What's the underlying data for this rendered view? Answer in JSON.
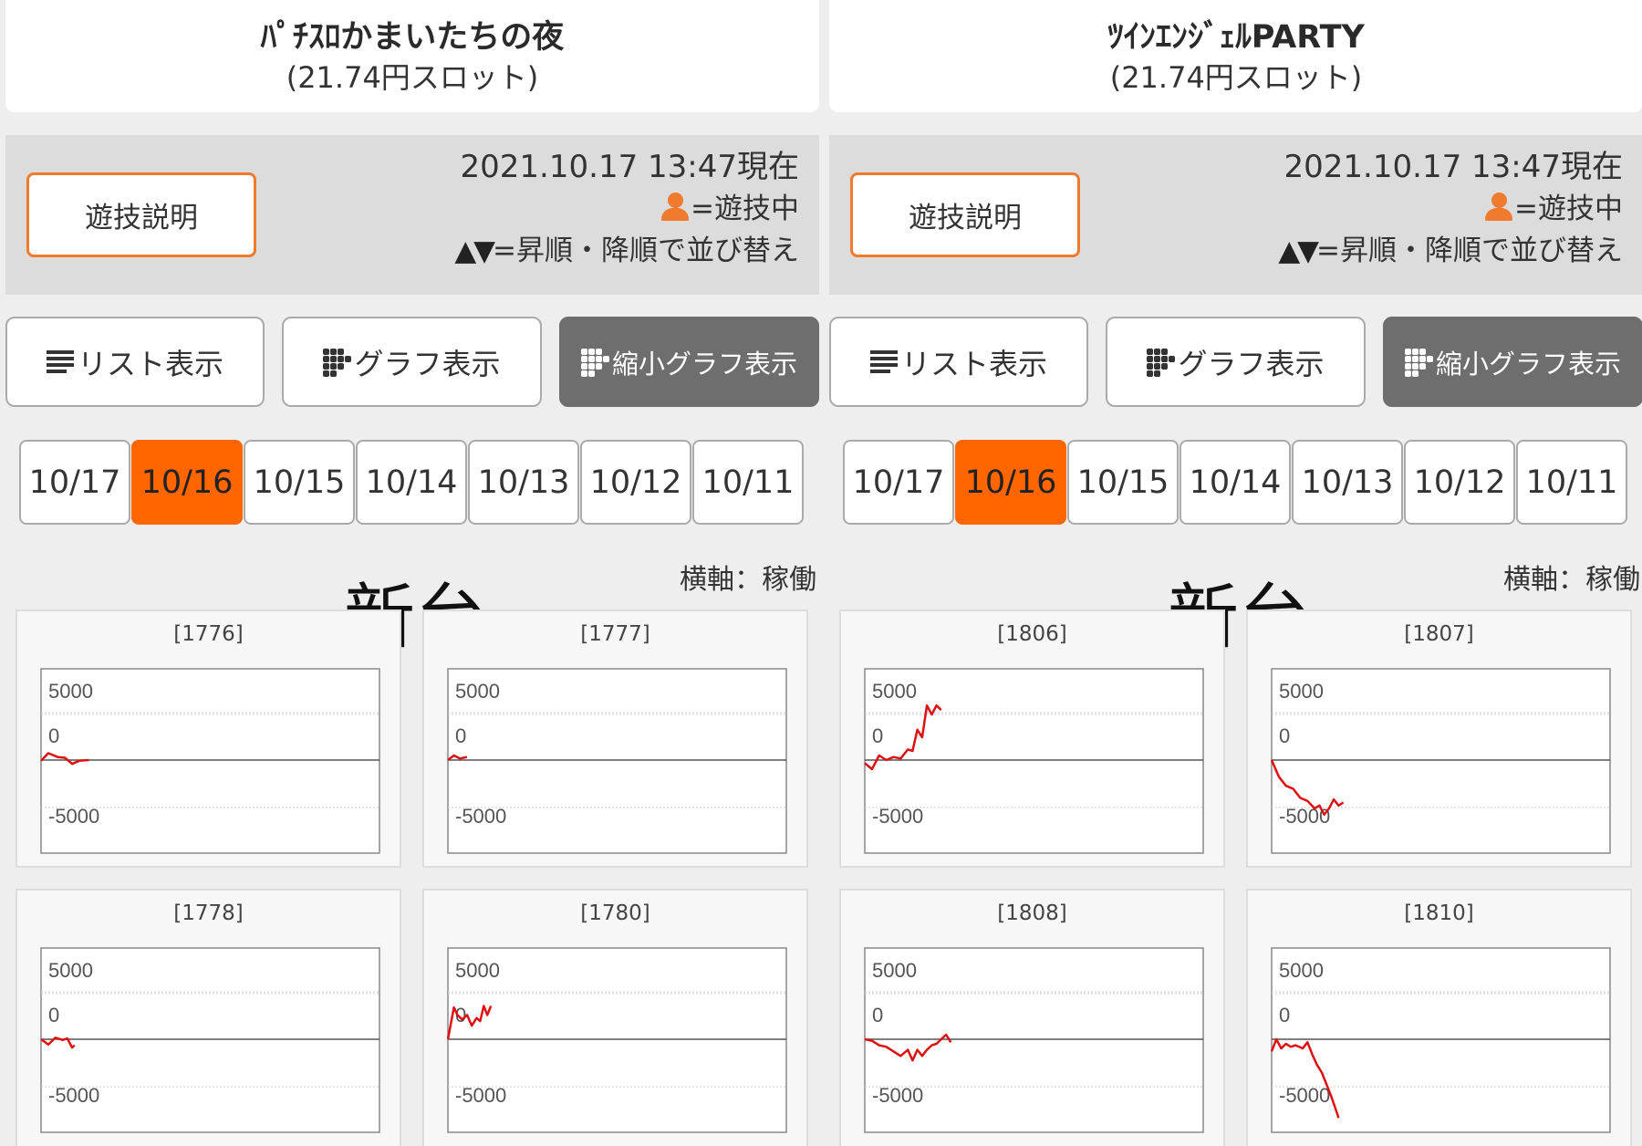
{
  "panels": [
    {
      "title": "ﾊﾟﾁｽﾛかまいたちの夜",
      "rate": "(21.74円スロット)",
      "explain_button": "遊技説明",
      "timestamp": "2021.10.17 13:47現在",
      "playing_legend": "=遊技中",
      "sort_legend": "=昇順・降順で並び替え",
      "view_buttons": [
        "リスト表示",
        "グラフ表示",
        "縮小グラフ表示"
      ],
      "active_view": 2,
      "date_tabs": [
        "10/17",
        "10/16",
        "10/15",
        "10/14",
        "10/13",
        "10/12",
        "10/11"
      ],
      "active_date": 1,
      "annotation": "新台",
      "axis_note": "横軸：稼働",
      "graphs": [
        {
          "id": "[1776]",
          "y_labels": [
            "5000",
            "0",
            "-5000"
          ],
          "series": [
            [
              0,
              -50
            ],
            [
              6,
              450
            ],
            [
              14,
              200
            ],
            [
              20,
              150
            ],
            [
              26,
              -250
            ],
            [
              32,
              -50
            ],
            [
              40,
              0
            ]
          ]
        },
        {
          "id": "[1777]",
          "y_labels": [
            "5000",
            "0",
            "-5000"
          ],
          "series": [
            [
              0,
              0
            ],
            [
              5,
              300
            ],
            [
              10,
              100
            ],
            [
              16,
              200
            ]
          ]
        },
        {
          "id": "[1778]",
          "y_labels": [
            "5000",
            "0",
            "-5000"
          ],
          "series": [
            [
              0,
              0
            ],
            [
              6,
              -350
            ],
            [
              12,
              100
            ],
            [
              18,
              -50
            ],
            [
              22,
              50
            ],
            [
              26,
              -550
            ],
            [
              28,
              -400
            ]
          ]
        },
        {
          "id": "[1780]",
          "y_labels": [
            "5000",
            "0",
            "-5000"
          ],
          "series": [
            [
              0,
              0
            ],
            [
              5,
              2100
            ],
            [
              8,
              1600
            ],
            [
              12,
              1300
            ],
            [
              16,
              1600
            ],
            [
              20,
              900
            ],
            [
              24,
              1400
            ],
            [
              27,
              1200
            ],
            [
              30,
              2200
            ],
            [
              33,
              1600
            ],
            [
              36,
              2200
            ]
          ]
        }
      ]
    },
    {
      "title": "ﾂｲﾝｴﾝｼﾞｪﾙPARTY",
      "rate": "(21.74円スロット)",
      "explain_button": "遊技説明",
      "timestamp": "2021.10.17 13:47現在",
      "playing_legend": "=遊技中",
      "sort_legend": "=昇順・降順で並び替え",
      "view_buttons": [
        "リスト表示",
        "グラフ表示",
        "縮小グラフ表示"
      ],
      "active_view": 2,
      "date_tabs": [
        "10/17",
        "10/16",
        "10/15",
        "10/14",
        "10/13",
        "10/12",
        "10/11"
      ],
      "active_date": 1,
      "annotation": "新台",
      "axis_note": "横軸：稼働",
      "graphs": [
        {
          "id": "[1806]",
          "y_labels": [
            "5000",
            "0",
            "-5000"
          ],
          "series": [
            [
              0,
              -200
            ],
            [
              6,
              -600
            ],
            [
              12,
              300
            ],
            [
              18,
              0
            ],
            [
              24,
              200
            ],
            [
              30,
              100
            ],
            [
              36,
              700
            ],
            [
              40,
              600
            ],
            [
              44,
              2000
            ],
            [
              48,
              1500
            ],
            [
              52,
              3600
            ],
            [
              56,
              3000
            ],
            [
              60,
              3600
            ],
            [
              64,
              3300
            ]
          ]
        },
        {
          "id": "[1807]",
          "y_labels": [
            "5000",
            "0",
            "-5000"
          ],
          "series": [
            [
              0,
              0
            ],
            [
              6,
              -1100
            ],
            [
              12,
              -1700
            ],
            [
              18,
              -1900
            ],
            [
              24,
              -2500
            ],
            [
              30,
              -2700
            ],
            [
              36,
              -3200
            ],
            [
              40,
              -3000
            ],
            [
              44,
              -3600
            ],
            [
              48,
              -3200
            ],
            [
              52,
              -2600
            ],
            [
              56,
              -3000
            ],
            [
              60,
              -2800
            ]
          ]
        },
        {
          "id": "[1808]",
          "y_labels": [
            "5000",
            "0",
            "-5000"
          ],
          "series": [
            [
              0,
              0
            ],
            [
              6,
              -100
            ],
            [
              12,
              -400
            ],
            [
              18,
              -500
            ],
            [
              24,
              -800
            ],
            [
              30,
              -1100
            ],
            [
              36,
              -700
            ],
            [
              40,
              -1400
            ],
            [
              44,
              -700
            ],
            [
              48,
              -1100
            ],
            [
              52,
              -700
            ],
            [
              56,
              -400
            ],
            [
              60,
              -300
            ],
            [
              64,
              0
            ],
            [
              68,
              300
            ],
            [
              72,
              -200
            ]
          ]
        },
        {
          "id": "[1810]",
          "y_labels": [
            "5000",
            "0",
            "-5000"
          ],
          "series": [
            [
              0,
              -800
            ],
            [
              4,
              0
            ],
            [
              8,
              -600
            ],
            [
              12,
              -300
            ],
            [
              16,
              -500
            ],
            [
              20,
              -400
            ],
            [
              26,
              -600
            ],
            [
              30,
              -200
            ],
            [
              34,
              -1000
            ],
            [
              38,
              -1700
            ],
            [
              42,
              -2200
            ],
            [
              46,
              -3000
            ],
            [
              50,
              -3800
            ],
            [
              54,
              -4700
            ],
            [
              56,
              -5200
            ]
          ]
        }
      ]
    }
  ]
}
